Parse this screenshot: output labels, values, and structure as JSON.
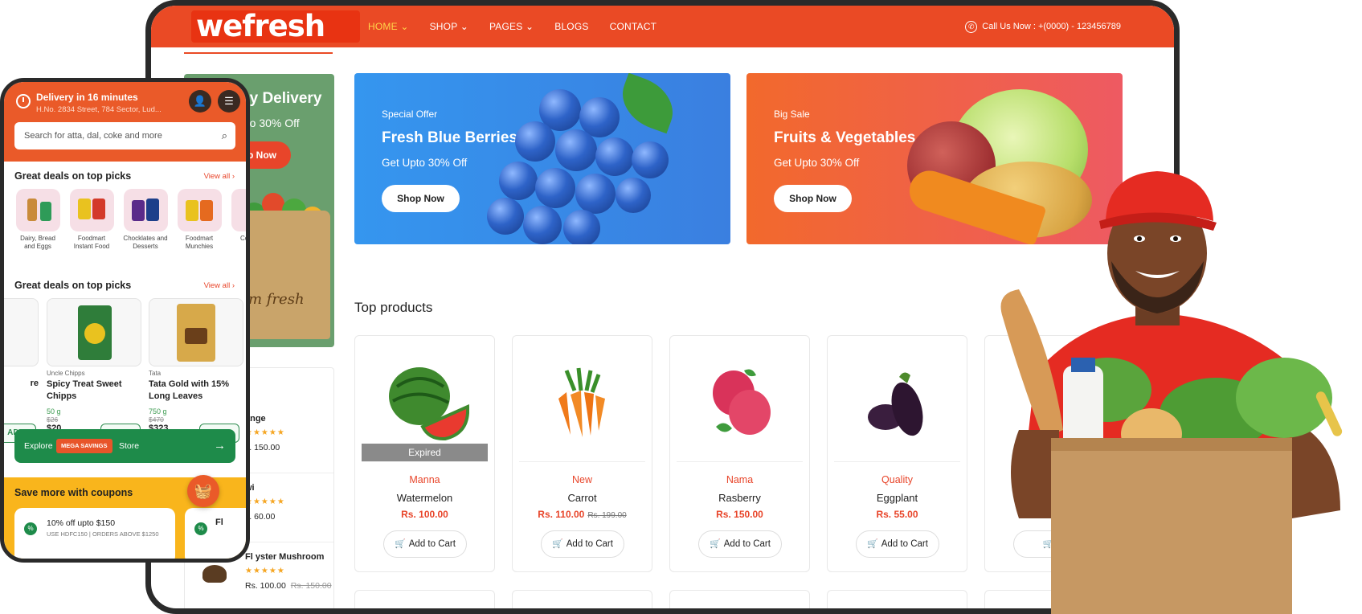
{
  "desktop": {
    "logo": "wefresh",
    "nav": [
      {
        "label": "HOME ⌄",
        "active": true
      },
      {
        "label": "SHOP ⌄",
        "active": false
      },
      {
        "label": "PAGES ⌄",
        "active": false
      },
      {
        "label": "BLOGS",
        "active": false
      },
      {
        "label": "CONTACT",
        "active": false
      }
    ],
    "call_now": "Call Us Now : +(0000) - 123456789",
    "left_promo": {
      "title": "ny Delivery",
      "subtitle": "pto 30% Off",
      "button": "op Now",
      "bag_text": "m fresh"
    },
    "banners": [
      {
        "subtitle": "Special Offer",
        "title": "Fresh Blue Berries",
        "offer": "Get Upto 30% Off",
        "button": "Shop Now"
      },
      {
        "subtitle": "Big Sale",
        "title": "Fruits & Vegetables",
        "offer": "Get Upto 30% Off",
        "button": "Shop Now"
      }
    ],
    "section_title": "Top products",
    "products": [
      {
        "category": "Manna",
        "name": "Watermelon",
        "price": "Rs. 100.00",
        "old_price": "",
        "badge": "Expired",
        "button": "Add to Cart"
      },
      {
        "category": "New",
        "name": "Carrot",
        "price": "Rs. 110.00",
        "old_price": "Rs. 199.00",
        "badge": "",
        "button": "Add to Cart"
      },
      {
        "category": "Nama",
        "name": "Rasberry",
        "price": "Rs. 150.00",
        "old_price": "",
        "badge": "",
        "button": "Add to Cart"
      },
      {
        "category": "Quality",
        "name": "Eggplant",
        "price": "Rs. 55.00",
        "old_price": "",
        "badge": "",
        "button": "Add to Cart"
      },
      {
        "category": "",
        "name": "",
        "price": "",
        "old_price": "",
        "badge": "",
        "button": "Ac"
      }
    ],
    "side_list": [
      {
        "name": "ange",
        "rating": "★★★★★",
        "price": "s. 150.00",
        "old_price": ""
      },
      {
        "name": "wi",
        "rating": "★★★★★",
        "price": "s. 60.00",
        "old_price": ""
      },
      {
        "name": "Fl   yster Mushroom",
        "rating": "★★★★★",
        "price": "Rs. 100.00",
        "old_price": "Rs. 150.00"
      }
    ]
  },
  "phone": {
    "delivery_title": "Delivery in 16 minutes",
    "address": "H.No. 2834 Street, 784 Sector, Lud...",
    "search_placeholder": "Search for atta, dal, coke and more",
    "section1": {
      "title": "Great deals on top picks",
      "view_all": "View all ›"
    },
    "categories": [
      "Dairy, Bread and Eggs",
      "Foodmart Instant Food",
      "Chocklates and Desserts",
      "Foodmart Munchies",
      "Cold and"
    ],
    "section2": {
      "title": "Great deals on top picks",
      "view_all": "View all ›"
    },
    "products": [
      {
        "brand": "",
        "name": "re",
        "weight": "",
        "old_price": "",
        "price": "",
        "button": "ADD"
      },
      {
        "brand": "Uncle Chipps",
        "name": "Spicy Treat Sweet Chipps",
        "weight": "50 g",
        "old_price": "$26",
        "price": "$20",
        "button": "ADD"
      },
      {
        "brand": "Tata",
        "name": "Tata Gold with 15% Long Leaves",
        "weight": "750 g",
        "old_price": "$470",
        "price": "$323",
        "button": "ADD"
      }
    ],
    "explore": {
      "prefix": "Explore",
      "badge": "MEGA SAVINGS",
      "suffix": "Store",
      "arrow": "→"
    },
    "coupons": {
      "title": "Save more with coupons",
      "card_title": "10% off upto $150",
      "card_sub": "USE HDFC150 | ORDERS ABOVE $1250",
      "card2_title": "Fl"
    }
  },
  "colors": {
    "brand": "#ea4a25",
    "green": "#1e8b4a",
    "yellow": "#f9b51c",
    "blue_banner": "#3596ef"
  },
  "icons": [
    "phone-icon",
    "clock-icon",
    "user-icon",
    "menu-icon",
    "search-icon",
    "cart-icon",
    "basket-icon",
    "arrow-right-icon"
  ]
}
